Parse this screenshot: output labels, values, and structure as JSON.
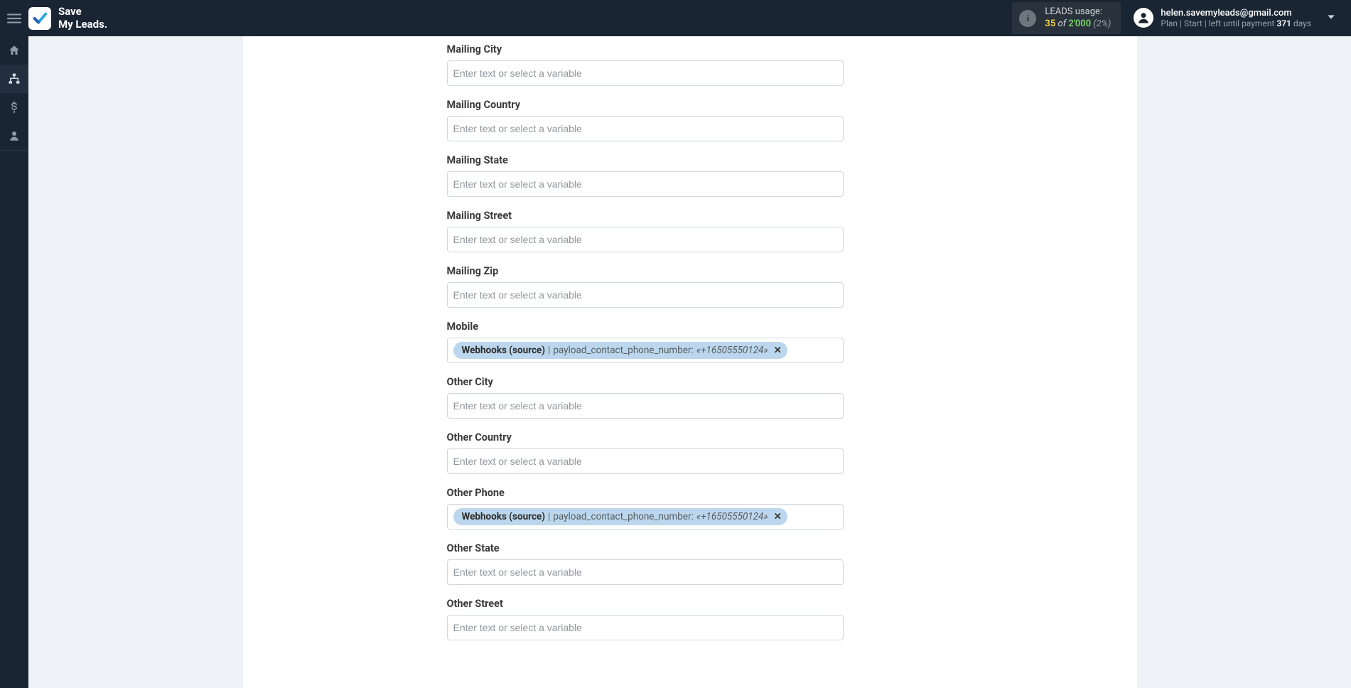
{
  "brand": {
    "line1": "Save",
    "line2": "My Leads."
  },
  "icons": {
    "hamburger": "hamburger-icon",
    "logo": "check-logo-icon",
    "info": "info-icon",
    "avatar": "user-avatar-icon",
    "chevron": "chevron-down-icon",
    "home": "home-icon",
    "sitemap": "sitemap-icon",
    "dollar": "dollar-icon",
    "user": "user-icon"
  },
  "usage": {
    "label": "LEADS usage:",
    "used": "35",
    "of_word": "of",
    "total": "2'000",
    "pct": "(2%)"
  },
  "account": {
    "email": "helen.savemyleads@gmail.com",
    "plan_prefix": "Plan |",
    "plan_name": "Start",
    "plan_mid": "| left until payment",
    "days_num": "371",
    "days_word": "days"
  },
  "placeholder": "Enter text or select a variable",
  "chip": {
    "source": "Webhooks (source)",
    "pipe": " | ",
    "path": "payload_contact_phone_number:",
    "value": "«+16505550124»"
  },
  "fields": [
    {
      "key": "mailing_city",
      "label": "Mailing City",
      "hasChip": false
    },
    {
      "key": "mailing_country",
      "label": "Mailing Country",
      "hasChip": false
    },
    {
      "key": "mailing_state",
      "label": "Mailing State",
      "hasChip": false
    },
    {
      "key": "mailing_street",
      "label": "Mailing Street",
      "hasChip": false
    },
    {
      "key": "mailing_zip",
      "label": "Mailing Zip",
      "hasChip": false
    },
    {
      "key": "mobile",
      "label": "Mobile",
      "hasChip": true
    },
    {
      "key": "other_city",
      "label": "Other City",
      "hasChip": false
    },
    {
      "key": "other_country",
      "label": "Other Country",
      "hasChip": false
    },
    {
      "key": "other_phone",
      "label": "Other Phone",
      "hasChip": true
    },
    {
      "key": "other_state",
      "label": "Other State",
      "hasChip": false
    },
    {
      "key": "other_street",
      "label": "Other Street",
      "hasChip": false
    }
  ]
}
